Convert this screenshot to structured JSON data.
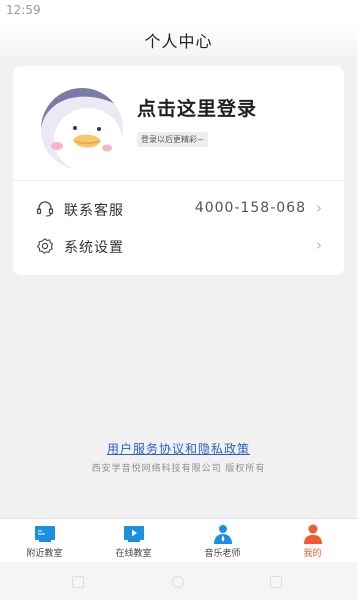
{
  "status_bar": {
    "time": "12:59"
  },
  "header": {
    "title": "个人中心"
  },
  "profile": {
    "login_title": "点击这里登录",
    "login_subtitle": "登录以后更精彩~",
    "avatar": "duck-avatar-icon"
  },
  "menu": {
    "items": [
      {
        "label": "联系客服",
        "value": "4000-158-068",
        "icon": "headset-icon"
      },
      {
        "label": "系统设置",
        "value": "",
        "icon": "gear-icon"
      }
    ]
  },
  "footer": {
    "policy_link": "用户服务协议和隐私政策",
    "copyright": "西安学音悦网络科技有限公司 版权所有"
  },
  "tabs": [
    {
      "label": "附近教室",
      "icon": "classroom-icon",
      "active": false
    },
    {
      "label": "在线教室",
      "icon": "video-play-icon",
      "active": false
    },
    {
      "label": "音乐老师",
      "icon": "teacher-icon",
      "active": false
    },
    {
      "label": "我的",
      "icon": "user-icon",
      "active": true
    }
  ],
  "colors": {
    "accent": "#f25a36",
    "link": "#2b62c8",
    "tab_icon_blue": "#1c8fe0",
    "background": "#f1f1f1"
  }
}
